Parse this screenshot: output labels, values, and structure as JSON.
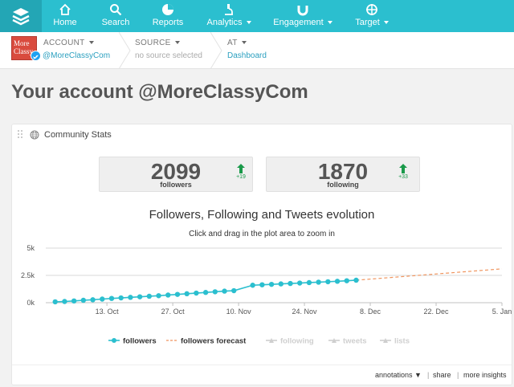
{
  "nav": {
    "items": [
      {
        "label": "Home",
        "icon": "home-icon",
        "dropdown": false
      },
      {
        "label": "Search",
        "icon": "search-icon",
        "dropdown": false
      },
      {
        "label": "Reports",
        "icon": "pie-chart-icon",
        "dropdown": false
      },
      {
        "label": "Analytics",
        "icon": "microscope-icon",
        "dropdown": true
      },
      {
        "label": "Engagement",
        "icon": "magnet-icon",
        "dropdown": true
      },
      {
        "label": "Target",
        "icon": "crosshair-icon",
        "dropdown": true
      }
    ],
    "bg_color": "#2bbfcf"
  },
  "breadcrumb": {
    "account": {
      "key": "ACCOUNT",
      "value": "@MoreClassyCom",
      "avatar_text": "More Classy"
    },
    "source": {
      "key": "SOURCE",
      "value": "no source selected"
    },
    "at": {
      "key": "AT",
      "value": "Dashboard"
    }
  },
  "page": {
    "title": "Your account @MoreClassyCom"
  },
  "widget": {
    "title": "Community Stats",
    "stats": [
      {
        "value": "2099",
        "caption": "followers",
        "delta": "+19"
      },
      {
        "value": "1870",
        "caption": "following",
        "delta": "+33"
      }
    ],
    "footer": {
      "annotations": "annotations ▼",
      "share": "share",
      "more": "more insights"
    }
  },
  "chart_data": {
    "type": "line",
    "title": "Followers, Following and Tweets evolution",
    "subtitle": "Click and drag in the plot area to zoom in",
    "x_tick_labels": [
      "13. Oct",
      "27. Oct",
      "10. Nov",
      "24. Nov",
      "8. Dec",
      "22. Dec",
      "5. Jan"
    ],
    "y_tick_labels": [
      "0k",
      "2.5k",
      "5k"
    ],
    "ylim": [
      0,
      5000
    ],
    "series": [
      {
        "name": "followers",
        "color": "#2bbfcf",
        "x": [
          "2014-10-02",
          "2014-10-04",
          "2014-10-06",
          "2014-10-08",
          "2014-10-10",
          "2014-10-12",
          "2014-10-14",
          "2014-10-16",
          "2014-10-18",
          "2014-10-20",
          "2014-10-22",
          "2014-10-24",
          "2014-10-26",
          "2014-10-28",
          "2014-10-30",
          "2014-11-01",
          "2014-11-03",
          "2014-11-05",
          "2014-11-07",
          "2014-11-09",
          "2014-11-13",
          "2014-11-15",
          "2014-11-17",
          "2014-11-19",
          "2014-11-21",
          "2014-11-23",
          "2014-11-25",
          "2014-11-27",
          "2014-11-29",
          "2014-12-01",
          "2014-12-03",
          "2014-12-05"
        ],
        "values": [
          80,
          110,
          160,
          220,
          270,
          330,
          390,
          440,
          490,
          540,
          590,
          640,
          700,
          760,
          820,
          880,
          940,
          1000,
          1060,
          1100,
          1600,
          1640,
          1680,
          1720,
          1760,
          1800,
          1840,
          1880,
          1920,
          1960,
          2010,
          2060
        ]
      },
      {
        "name": "followers forecast",
        "color": "#f0955f",
        "style": "dashed",
        "x": [
          "2014-12-05",
          "2015-01-05"
        ],
        "values": [
          2060,
          3100
        ]
      },
      {
        "name": "following",
        "hidden": true
      },
      {
        "name": "tweets",
        "hidden": true
      },
      {
        "name": "lists",
        "hidden": true
      }
    ],
    "legend": [
      "followers",
      "followers forecast",
      "following",
      "tweets",
      "lists"
    ],
    "legend_position": "bottom",
    "grid": true
  }
}
